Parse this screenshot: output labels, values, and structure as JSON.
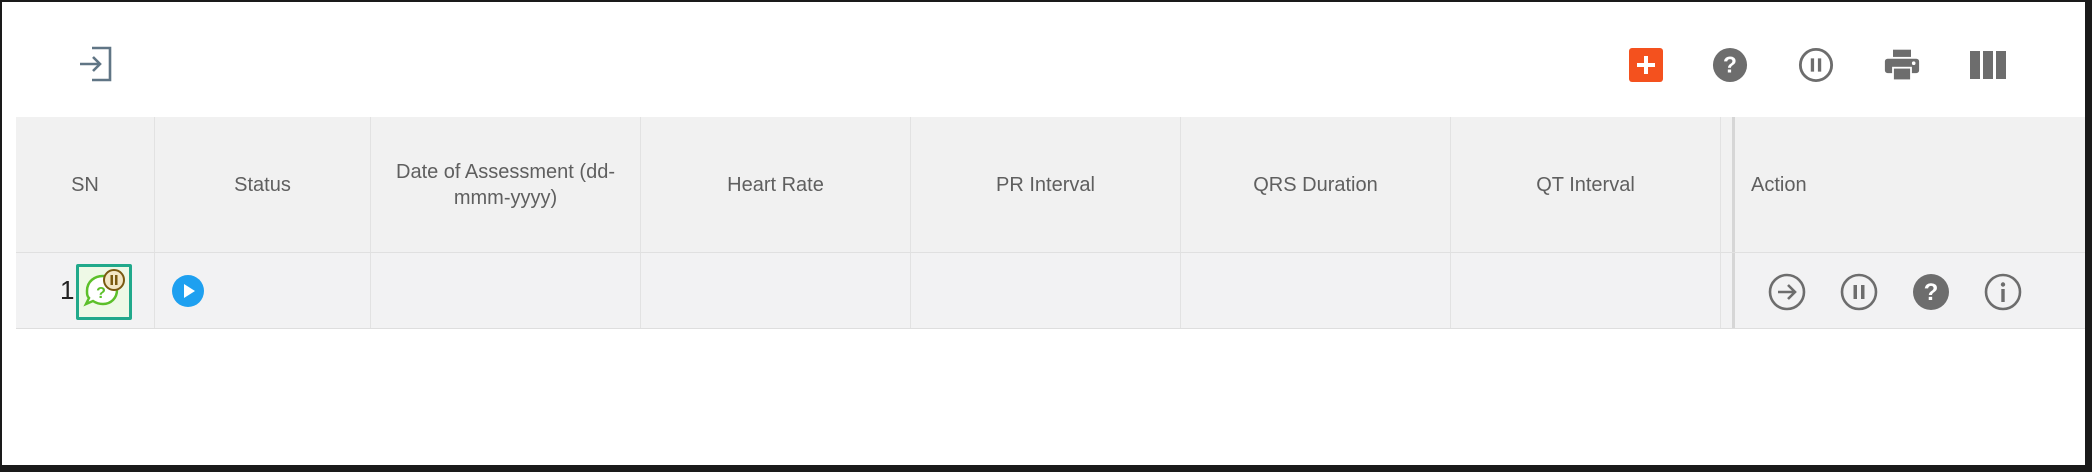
{
  "toolbar": {
    "exit_icon": "sign-in-icon",
    "add_icon": "add-icon",
    "add_color": "#f4511e",
    "help_icon": "help-circle-icon",
    "pause_icon": "pause-circle-icon",
    "print_icon": "print-icon",
    "columns_icon": "view-column-icon",
    "icon_color": "#6d6d6d"
  },
  "table": {
    "columns": [
      "SN",
      "Status",
      "Date of Assessment (dd-mmm-yyyy)",
      "Heart Rate",
      "PR Interval",
      "QRS Duration",
      "QT Interval",
      "Action"
    ],
    "rows": [
      {
        "sn": "1",
        "flag_icon": "chat-question-paused-icon",
        "status_icon": "play-circle-icon",
        "status_color": "#1ea0f0",
        "date": "",
        "heart_rate": "",
        "pr_interval": "",
        "qrs_duration": "",
        "qt_interval": "",
        "actions": [
          "arrow-right-circle-icon",
          "pause-circle-icon",
          "help-circle-icon",
          "info-circle-icon"
        ]
      }
    ]
  }
}
